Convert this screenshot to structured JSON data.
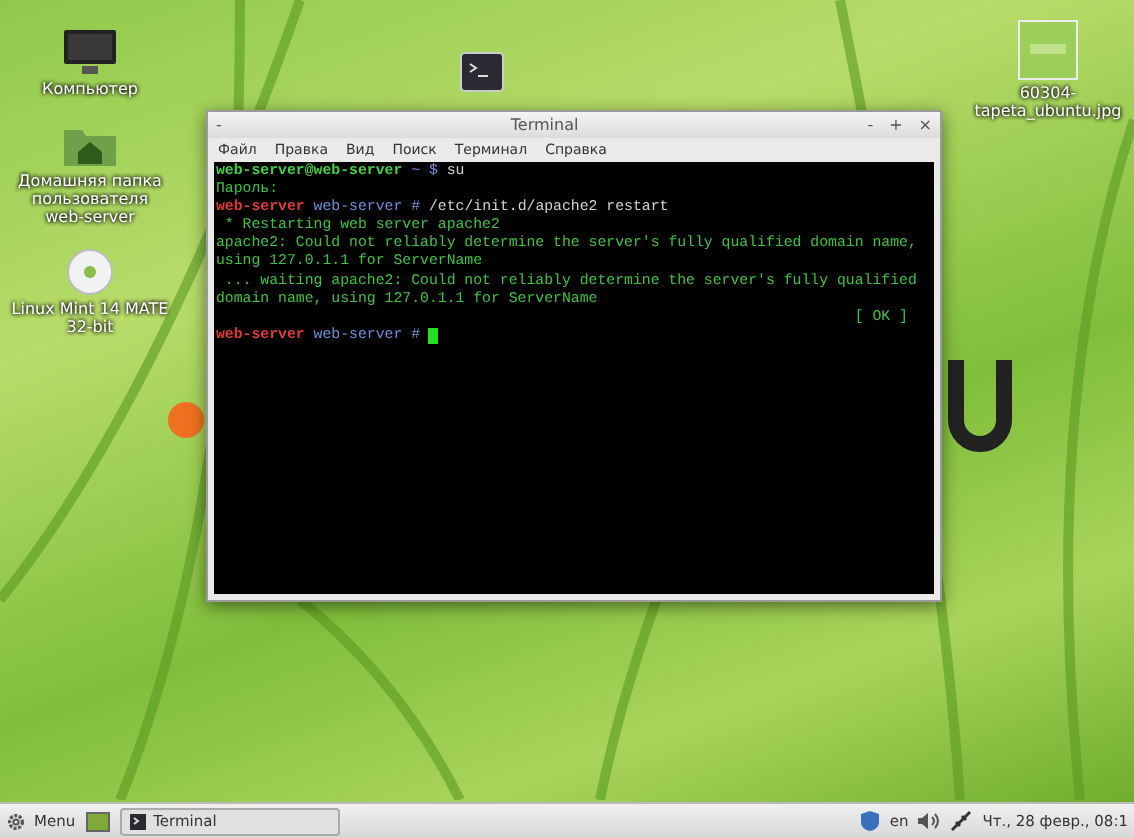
{
  "desktop": {
    "icons": [
      {
        "kind": "computer",
        "label": "Компьютер"
      },
      {
        "kind": "home",
        "label": "Домашняя папка пользователя web-server"
      },
      {
        "kind": "disc",
        "label": "Linux Mint 14 MATE 32-bit"
      },
      {
        "kind": "image",
        "label": "60304-tapeta_ubuntu.jpg"
      },
      {
        "kind": "terminal"
      }
    ]
  },
  "window": {
    "title": "Terminal",
    "menu_button": "-",
    "controls": [
      "-",
      "+",
      "×"
    ],
    "menu": [
      "Файл",
      "Правка",
      "Вид",
      "Поиск",
      "Терминал",
      "Справка"
    ],
    "lines": [
      {
        "segments": [
          {
            "kind": "user",
            "text": "web-server@web-server"
          },
          {
            "kind": "path",
            "text": " ~ $"
          },
          {
            "kind": "command",
            "text": " su"
          }
        ]
      },
      {
        "segments": [
          {
            "kind": "output",
            "text": "Пароль:"
          }
        ]
      },
      {
        "segments": [
          {
            "kind": "root",
            "text": "web-server"
          },
          {
            "kind": "path",
            "text": " web-server #"
          },
          {
            "kind": "command",
            "text": " /etc/init.d/apache2 restart"
          }
        ]
      },
      {
        "segments": [
          {
            "kind": "output",
            "text": " * Restarting web server apache2"
          }
        ]
      },
      {
        "segments": [
          {
            "kind": "output",
            "text": "apache2: Could not reliably determine the server's fully qualified domain name,"
          }
        ]
      },
      {
        "segments": [
          {
            "kind": "output",
            "text": "using 127.0.1.1 for ServerName"
          }
        ]
      },
      {
        "segments": [
          {
            "kind": "output",
            "text": " ... waiting apache2: Could not reliably determine the server's fully qualified"
          }
        ]
      },
      {
        "segments": [
          {
            "kind": "output",
            "text": "domain name, using 127.0.1.1 for ServerName"
          }
        ]
      },
      {
        "segments": [
          {
            "kind": "status",
            "text": "[ OK ]"
          }
        ]
      },
      {
        "segments": [
          {
            "kind": "root",
            "text": "web-server"
          },
          {
            "kind": "path",
            "text": " web-server #"
          }
        ],
        "cursor": true
      }
    ]
  },
  "taskbar": {
    "menu_label": "Menu",
    "task": "Terminal",
    "language": "en",
    "clock": "Чт., 28 февр., 08:1"
  }
}
